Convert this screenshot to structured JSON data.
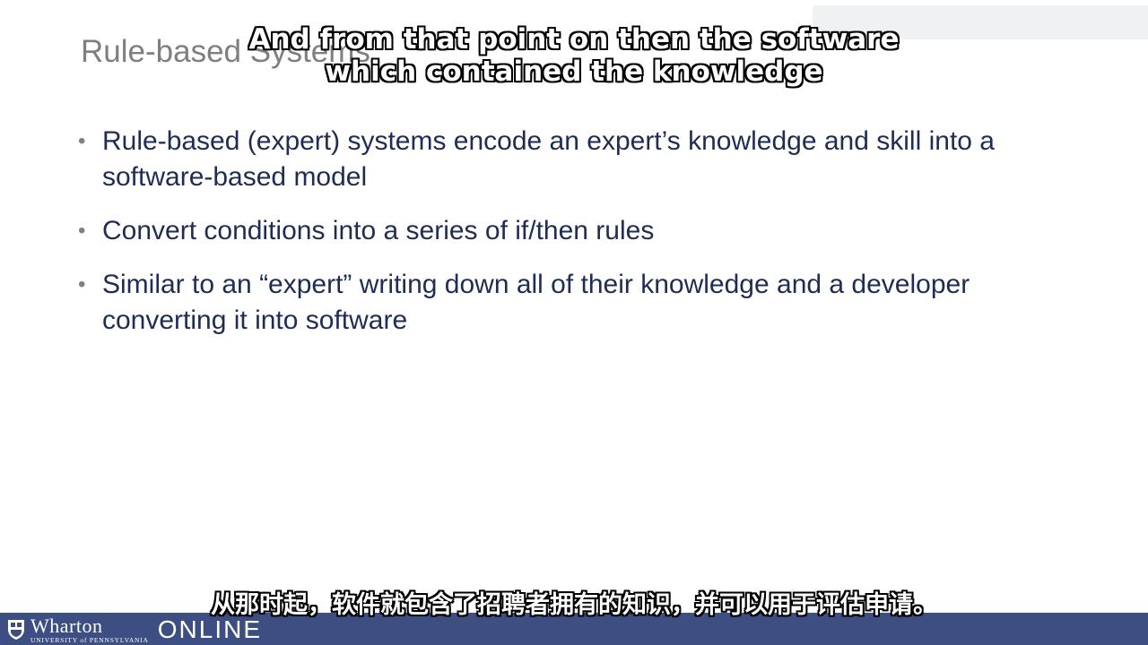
{
  "slide": {
    "title": "Rule-based Systems",
    "bullets": [
      {
        "text": "Rule-based (expert) systems encode an expert’s knowledge and skill into a software-based model"
      },
      {
        "text": "Convert conditions into a series of if/then rules"
      },
      {
        "text": "Similar to an “expert” writing down all of their knowledge and a developer converting it into software"
      }
    ],
    "bullet_glyph": "•"
  },
  "captions": {
    "english_line1": "And from that point on then the software",
    "english_line2": "which contained the knowledge",
    "chinese": "从那时起，软件就包含了招聘者拥有的知识，并可以用于评估申请。"
  },
  "footer": {
    "brand_name": "Wharton",
    "brand_sub": "UNIVERSITY of PENNSYLVANIA",
    "brand_online": "ONLINE"
  },
  "colors": {
    "title": "#7f7f7f",
    "body_text": "#1f2d54",
    "footer_bar": "#3d4f82"
  }
}
